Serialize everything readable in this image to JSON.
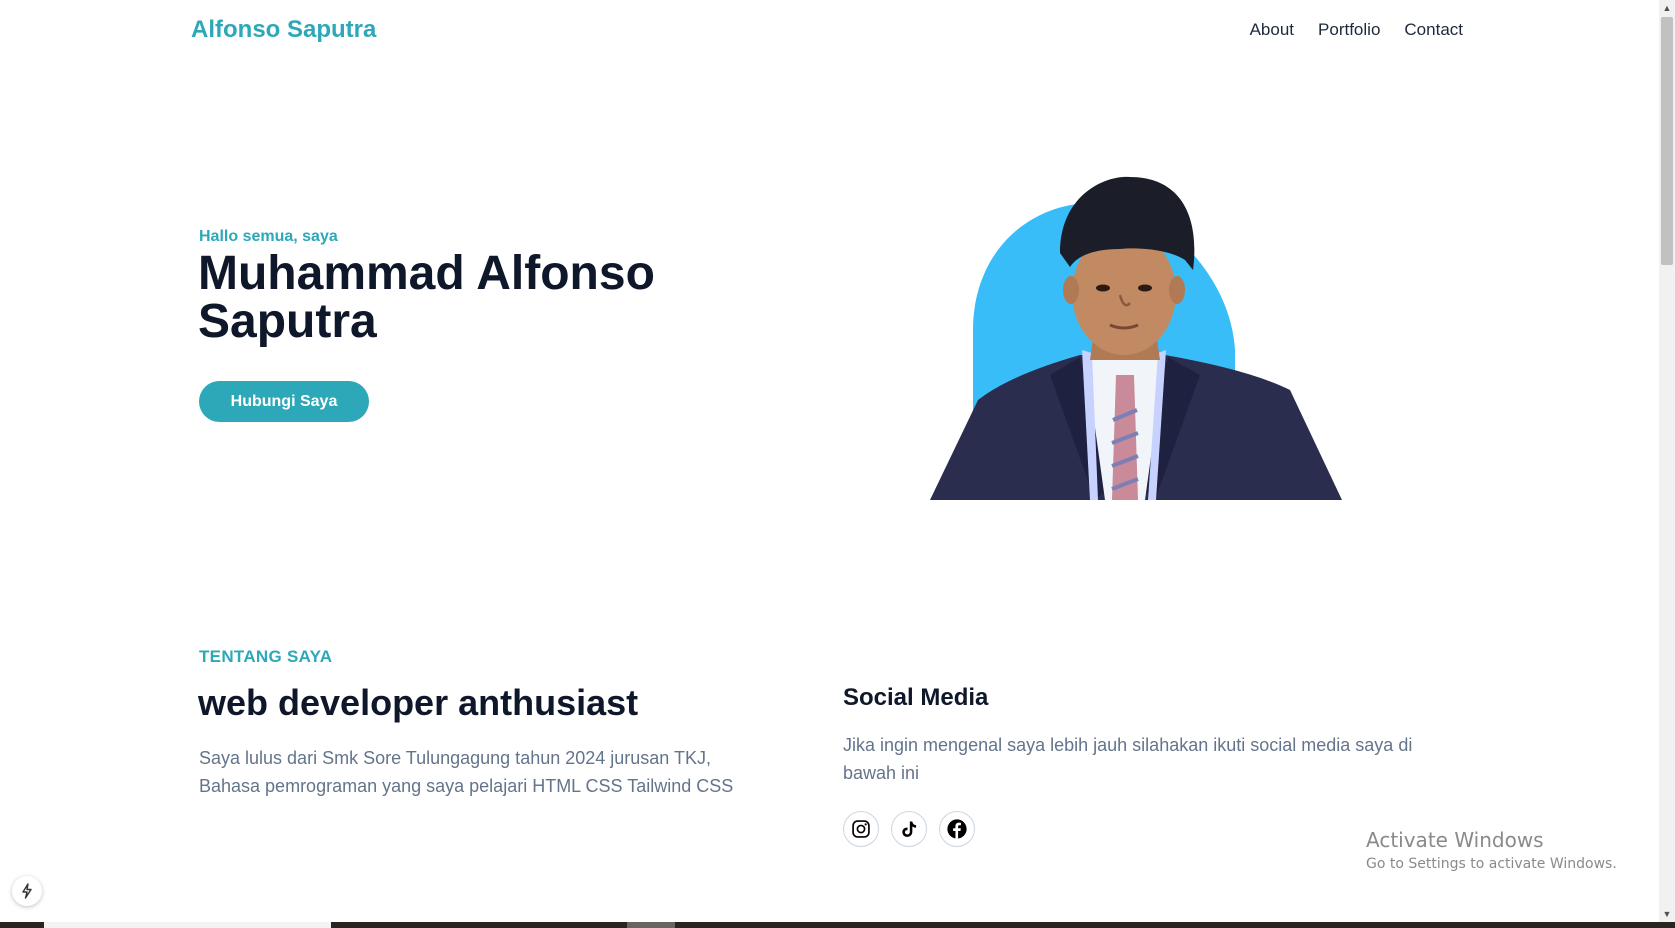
{
  "header": {
    "brand": "Alfonso Saputra",
    "nav": [
      "About",
      "Portfolio",
      "Contact"
    ]
  },
  "hero": {
    "greeting": "Hallo semua, saya",
    "name_line1": "Muhammad Alfonso",
    "name_line2": "Saputra",
    "cta_label": "Hubungi Saya"
  },
  "about": {
    "kicker": "TENTANG SAYA",
    "title": "web developer anthusiast",
    "text": "Saya lulus dari Smk Sore Tulungagung tahun 2024 jurusan TKJ, Bahasa pemrograman yang saya pelajari HTML CSS Tailwind CSS"
  },
  "social": {
    "title": "Social Media",
    "text": "Jika ingin mengenal saya lebih jauh silahakan ikuti social media saya di bawah ini",
    "icons": [
      "instagram-icon",
      "tiktok-icon",
      "facebook-icon"
    ]
  },
  "watermark": {
    "line1": "Activate Windows",
    "line2": "Go to Settings to activate Windows."
  },
  "colors": {
    "accent": "#2da8b8",
    "photo_bg": "#38bdf8",
    "heading": "#0f172a",
    "body_text": "#64748b"
  }
}
